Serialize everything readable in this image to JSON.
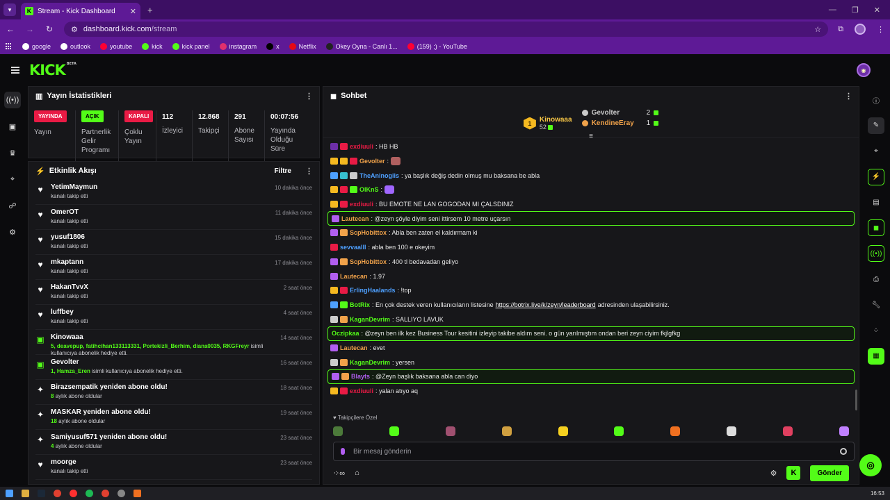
{
  "browser": {
    "tab_title": "Stream - Kick Dashboard",
    "url_domain": "dashboard.kick.com",
    "url_path": "/stream",
    "bookmarks": [
      {
        "label": "google",
        "color": "#ffffff"
      },
      {
        "label": "outlook",
        "color": "#ffffff"
      },
      {
        "label": "youtube",
        "color": "#ff0033"
      },
      {
        "label": "kick",
        "color": "#53fc18"
      },
      {
        "label": "kick panel",
        "color": "#53fc18"
      },
      {
        "label": "instagram",
        "color": "#e1306c"
      },
      {
        "label": "x",
        "color": "#000000"
      },
      {
        "label": "Netflix",
        "color": "#e50914"
      },
      {
        "label": "Okey Oyna - Canlı 1...",
        "color": "#222222"
      },
      {
        "label": "(159) ;) - YouTube",
        "color": "#ff0033"
      }
    ]
  },
  "header": {
    "logo": "KICK",
    "beta": "BETA"
  },
  "stats": {
    "title": "Yayın İstatistikleri",
    "items": [
      {
        "badge": "YAYINDA",
        "badge_style": "red",
        "label": "Yayın"
      },
      {
        "badge": "AÇIK",
        "badge_style": "green",
        "label": "Partnerlik Gelir Programı"
      },
      {
        "badge": "KAPALI",
        "badge_style": "red",
        "label": "Çoklu Yayın"
      },
      {
        "value": "112",
        "label": "İzleyici"
      },
      {
        "value": "12.868",
        "label": "Takipçi"
      },
      {
        "value": "291",
        "label": "Abone Sayısı"
      },
      {
        "value": "00:07:56",
        "label": "Yayında Olduğu Süre"
      }
    ]
  },
  "activity": {
    "title": "Etkinlik Akışı",
    "filter_label": "Filtre",
    "items": [
      {
        "icon": "heart",
        "name": "YetimMaymun",
        "sub": "kanalı takip etti",
        "highlight": "",
        "time": "10 dakika önce"
      },
      {
        "icon": "heart",
        "name": "OmerOT",
        "sub": "kanalı takip etti",
        "highlight": "",
        "time": "11 dakika önce"
      },
      {
        "icon": "heart",
        "name": "yusuf1806",
        "sub": "kanalı takip etti",
        "highlight": "",
        "time": "15 dakika önce"
      },
      {
        "icon": "heart",
        "name": "mkaptann",
        "sub": "kanalı takip etti",
        "highlight": "",
        "time": "17 dakika önce"
      },
      {
        "icon": "heart",
        "name": "HakanTvvX",
        "sub": "kanalı takip etti",
        "highlight": "",
        "time": "2 saat önce"
      },
      {
        "icon": "heart",
        "name": "luffbey",
        "sub": "kanalı takip etti",
        "highlight": "",
        "time": "4 saat önce"
      },
      {
        "icon": "gift",
        "name": "Kinowaaa",
        "highlight": "5, deavepup, fatihcihan133113331, Portekizli_Berhim, diana0035, RKGFreyr",
        "sub": "isimli kullanıcıya abonelik hediye etti.",
        "time": "14 saat önce"
      },
      {
        "icon": "gift",
        "name": "Gevolter",
        "highlight": "1, Hamza_Eren",
        "sub": "isimli kullanıcıya abonelik hediye etti.",
        "time": "16 saat önce"
      },
      {
        "icon": "star",
        "name": "Birazsempatik yeniden abone oldu!",
        "highlight": "8",
        "sub": "aylık abone oldular",
        "time": "18 saat önce"
      },
      {
        "icon": "star",
        "name": "MASKAR yeniden abone oldu!",
        "highlight": "18",
        "sub": "aylık abone oldular",
        "time": "19 saat önce"
      },
      {
        "icon": "star",
        "name": "Samiyusuf571 yeniden abone oldu!",
        "highlight": "4",
        "sub": "aylık abone oldular",
        "time": "23 saat önce"
      },
      {
        "icon": "heart",
        "name": "moorge",
        "sub": "kanalı takip etti",
        "highlight": "",
        "time": "23 saat önce"
      }
    ]
  },
  "chat": {
    "title": "Sohbet",
    "top_gifter": {
      "rank": "1",
      "name": "Kinowaaa",
      "count": "52"
    },
    "gifters": [
      {
        "name": "Gevolter",
        "count": "2",
        "color": "#c9c9c9"
      },
      {
        "name": "KendineEray",
        "count": "1",
        "color": "#f0a24a"
      }
    ],
    "messages": [
      {
        "badges": [
          "#6d2fa8",
          "#e91b45"
        ],
        "user": "exdiuuli",
        "color": "#e91b45",
        "text": ": HB HB",
        "hl": false,
        "emote": ""
      },
      {
        "badges": [
          "#f5b920",
          "#f5b920",
          "#e91b45"
        ],
        "user": "Gevolter",
        "color": "#f0a24a",
        "text": ":",
        "hl": false,
        "emote": "#b06060"
      },
      {
        "badges": [
          "#4ea0ff",
          "#37c0d0",
          "#cccccc"
        ],
        "user": "TheAninogiis",
        "color": "#4ea0ff",
        "text": ": ya başlık değiş dedin olmuş mu baksana be abla",
        "hl": false,
        "emote": ""
      },
      {
        "badges": [
          "#f5b920",
          "#e91b45",
          "#53fc18"
        ],
        "user": "OlKnS",
        "color": "#53fc18",
        "text": ":",
        "hl": false,
        "emote": "#a066ff"
      },
      {
        "badges": [
          "#f5b920",
          "#e91b45"
        ],
        "user": "exdiuuli",
        "color": "#e91b45",
        "text": ": BU EMOTE NE LAN GOGODAN MI ÇALSDINIZ",
        "hl": false,
        "emote": ""
      },
      {
        "badges": [
          "#b15ef0"
        ],
        "user": "Lautecan",
        "color": "#f0a24a",
        "text": ": @zeyn şöyle diyim seni ittirsem 10 metre uçarsın",
        "hl": true,
        "emote": ""
      },
      {
        "badges": [
          "#b15ef0",
          "#f0a24a"
        ],
        "user": "ScpHobittox",
        "color": "#f0a24a",
        "text": ": Abla ben zaten el kaldırmam ki",
        "hl": false,
        "emote": ""
      },
      {
        "badges": [
          "#e91b45"
        ],
        "user": "sevvaalll",
        "color": "#4ea0ff",
        "text": ": abla ben 100 e okeyim",
        "hl": false,
        "emote": ""
      },
      {
        "badges": [
          "#b15ef0",
          "#f0a24a"
        ],
        "user": "ScpHobittox",
        "color": "#f0a24a",
        "text": ": 400 tl bedavadan geliyo",
        "hl": false,
        "emote": ""
      },
      {
        "badges": [
          "#b15ef0"
        ],
        "user": "Lautecan",
        "color": "#f0a24a",
        "text": ": 1.97",
        "hl": false,
        "emote": ""
      },
      {
        "badges": [
          "#f5b920",
          "#e91b45"
        ],
        "user": "ErlingHaalands",
        "color": "#4ea0ff",
        "text": ": !top",
        "hl": false,
        "emote": ""
      },
      {
        "badges": [
          "#4ea0ff",
          "#53fc18"
        ],
        "user": "BotRix",
        "color": "#53fc18",
        "text": ": En çok destek veren kullanıcıların listesine",
        "link": "https://botrix.live/k/zeyn/leaderboard",
        "after": " adresinden ulaşabilirsiniz.",
        "hl": false,
        "emote": ""
      },
      {
        "badges": [
          "#cccccc",
          "#f0a24a"
        ],
        "user": "KaganDevrim",
        "color": "#53fc18",
        "text": ": SALLIYO LAVUK",
        "hl": false,
        "emote": ""
      },
      {
        "badges": [],
        "user": "Oczipkaa",
        "color": "#53fc18",
        "text": ": @zeyn ben ilk kez Business Tour kesitini izleyip takibe aldım seni. o gün yarılmıştım ondan beri zeyn ciyim fkjlgfkg",
        "hl": true,
        "emote": ""
      },
      {
        "badges": [
          "#b15ef0"
        ],
        "user": "Lautecan",
        "color": "#f0a24a",
        "text": ": evet",
        "hl": false,
        "emote": ""
      },
      {
        "badges": [
          "#cccccc",
          "#f0a24a"
        ],
        "user": "KaganDevrim",
        "color": "#53fc18",
        "text": ": yersen",
        "hl": false,
        "emote": ""
      },
      {
        "badges": [
          "#b15ef0",
          "#f0a24a"
        ],
        "user": "Blayts",
        "color": "#b15ef0",
        "text": ": @Zeyn başlık baksana abla can diyo",
        "hl": true,
        "emote": ""
      },
      {
        "badges": [
          "#f5b920",
          "#e91b45"
        ],
        "user": "exdiuuli",
        "color": "#e91b45",
        "text": ": yalan atıyo aq",
        "hl": false,
        "emote": ""
      }
    ],
    "followers_only": "Takipçilere Özel",
    "emote_colors": [
      "#4c7a3a",
      "#53fc18",
      "#a05070",
      "#d0a040",
      "#f5d020",
      "#53fc18",
      "#f07020",
      "#dddddd",
      "#e04060",
      "#c080ff"
    ],
    "input_placeholder": "Bir mesaj gönderin",
    "send_label": "Gönder"
  },
  "clock": "16:53"
}
